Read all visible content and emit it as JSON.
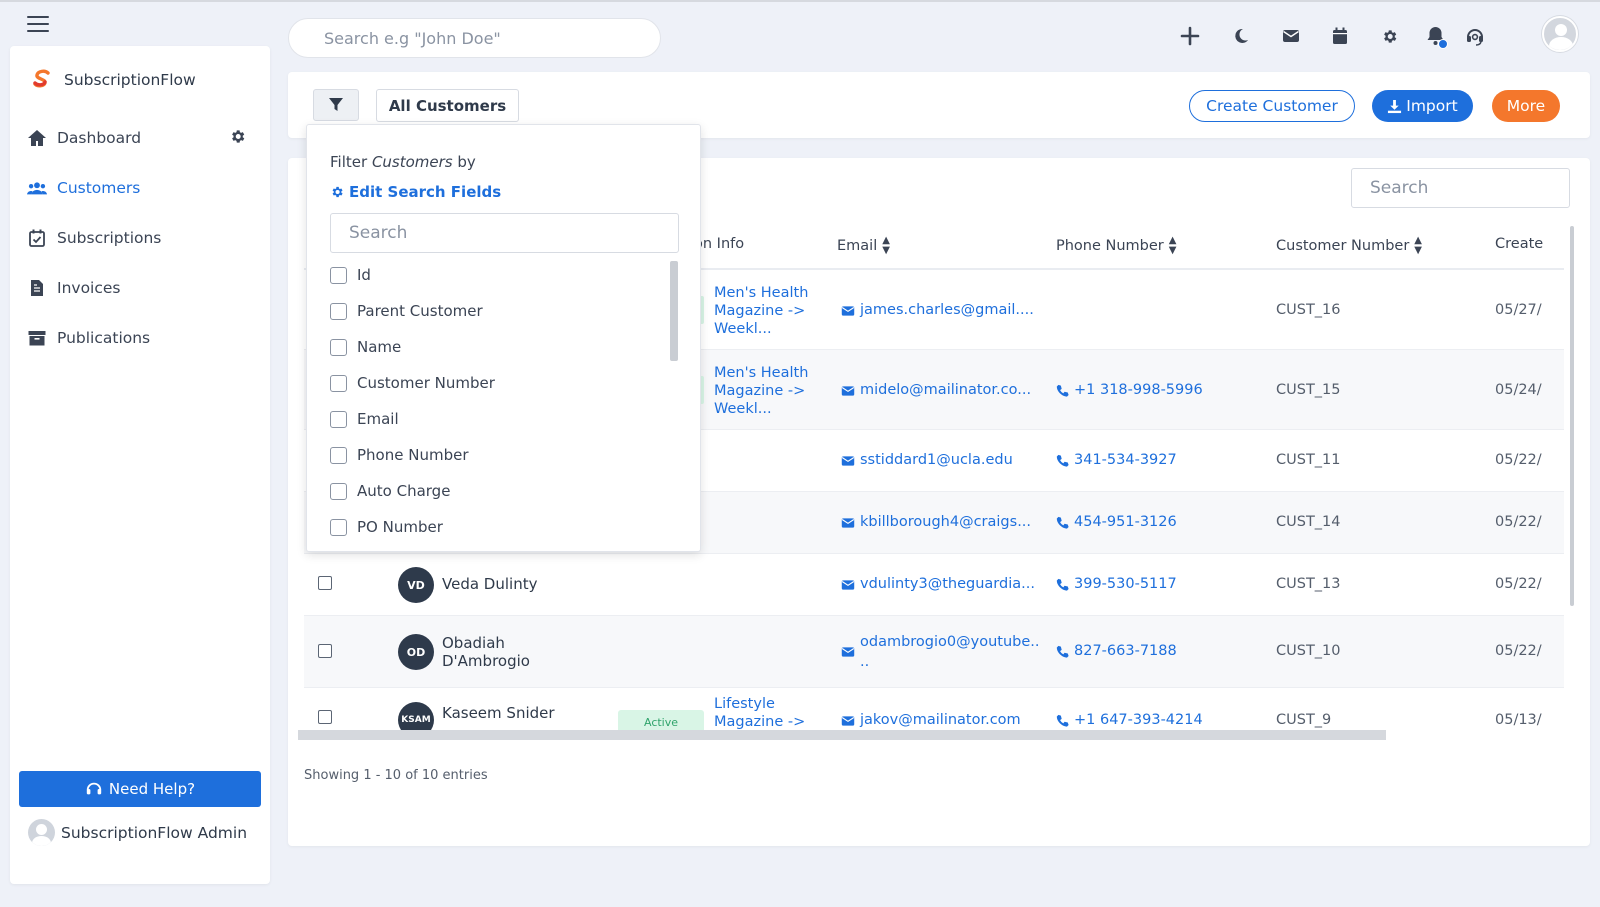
{
  "app": {
    "brand": "SubscriptionFlow"
  },
  "topbar": {
    "search_placeholder": "Search e.g \"John Doe\"",
    "icons": [
      "plus-icon",
      "moon-icon",
      "mail-icon",
      "calendar-icon",
      "gear-icon",
      "bell-icon",
      "headset-icon",
      "user-avatar"
    ]
  },
  "sidebar": {
    "items": [
      {
        "label": "Dashboard",
        "icon": "home-icon",
        "active": false
      },
      {
        "label": "Customers",
        "icon": "users-icon",
        "active": true
      },
      {
        "label": "Subscriptions",
        "icon": "calendar-check-icon",
        "active": false
      },
      {
        "label": "Invoices",
        "icon": "invoice-icon",
        "active": false
      },
      {
        "label": "Publications",
        "icon": "archive-icon",
        "active": false
      }
    ],
    "help_label": "Need Help?",
    "admin_label": "SubscriptionFlow Admin"
  },
  "header": {
    "view_label": "All Customers",
    "create_label": "Create Customer",
    "import_label": "Import",
    "more_label": "More"
  },
  "table": {
    "search_placeholder": "Search",
    "columns": {
      "plan": "on Info",
      "email": "Email",
      "phone": "Phone Number",
      "customer_number": "Customer Number",
      "created": "Create"
    },
    "rows": [
      {
        "plan": [
          "Men's Health",
          "Magazine ->",
          "Weekl..."
        ],
        "email": "james.charles@gmail....",
        "phone": "",
        "customer_number": "CUST_16",
        "created": "05/27/"
      },
      {
        "plan": [
          "Men's Health",
          "Magazine ->",
          "Weekl..."
        ],
        "email": "midelo@mailinator.co...",
        "phone": "+1 318-998-5996",
        "customer_number": "CUST_15",
        "created": "05/24/"
      },
      {
        "plan": [],
        "email": "sstiddard1@ucla.edu",
        "phone": "341-534-3927",
        "customer_number": "CUST_11",
        "created": "05/22/"
      },
      {
        "plan": [],
        "email": "kbillborough4@craigs...",
        "phone": "454-951-3126",
        "customer_number": "CUST_14",
        "created": "05/22/"
      },
      {
        "initials": "VD",
        "name": [
          "Veda Dulinty"
        ],
        "plan": [],
        "email": "vdulinty3@theguardia...",
        "phone": "399-530-5117",
        "customer_number": "CUST_13",
        "created": "05/22/"
      },
      {
        "initials": "OD",
        "name": [
          "Obadiah",
          "D'Ambrogio"
        ],
        "plan": [],
        "email": "odambrogio0@youtube..",
        "email2": "..",
        "phone": "827-663-7188",
        "customer_number": "CUST_10",
        "created": "05/22/"
      },
      {
        "initials": "KSAM",
        "name": [
          "Kaseem Snider"
        ],
        "status": "Active",
        "plan": [
          "Lifestyle",
          "Magazine ->"
        ],
        "email": "jakov@mailinator.com",
        "phone": "+1 647-393-4214",
        "customer_number": "CUST_9",
        "created": "05/13/"
      }
    ],
    "footer": "Showing 1 - 10 of 10 entries"
  },
  "filter_popover": {
    "title_prefix": "Filter",
    "title_entity": "Customers",
    "title_suffix": "by",
    "edit_label": "Edit Search Fields",
    "search_placeholder": "Search",
    "fields": [
      "Id",
      "Parent Customer",
      "Name",
      "Customer Number",
      "Email",
      "Phone Number",
      "Auto Charge",
      "PO Number"
    ]
  },
  "colors": {
    "primary": "#1e6fdc",
    "orange": "#f4772c",
    "active_green": "#2fa36b",
    "active_bg": "#d9f5e6"
  }
}
